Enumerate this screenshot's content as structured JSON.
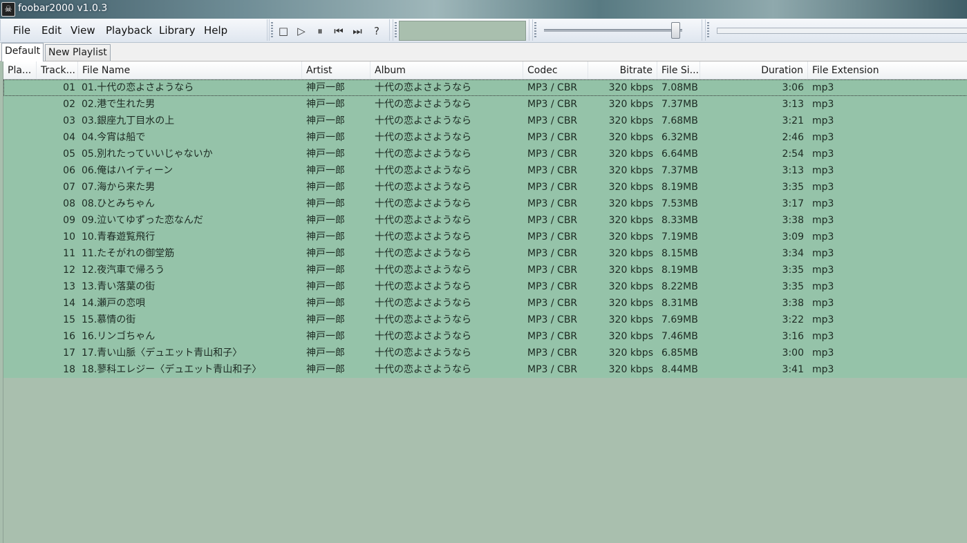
{
  "window": {
    "title": "foobar2000 v1.0.3",
    "icon": "skull-icon"
  },
  "menu": {
    "items": [
      {
        "label": "File"
      },
      {
        "label": "Edit"
      },
      {
        "label": "View"
      },
      {
        "label": "Playback"
      },
      {
        "label": "Library"
      },
      {
        "label": "Help"
      }
    ]
  },
  "transport": {
    "stop": "□",
    "play": "▷",
    "pause": "⏸",
    "prev": "⏮",
    "next": "⏭",
    "random": "?"
  },
  "volume": {
    "level": 0.95
  },
  "tabs": [
    {
      "label": "Default",
      "active": true
    },
    {
      "label": "New Playlist",
      "active": false
    }
  ],
  "columns": {
    "playing": "Pla...",
    "track": "Track...",
    "file_name": "File Name",
    "artist": "Artist",
    "album": "Album",
    "codec": "Codec",
    "bitrate": "Bitrate",
    "file_size": "File Si...",
    "duration": "Duration",
    "extension": "File Extension"
  },
  "rows": [
    {
      "track": "01",
      "file": "01.十代の恋よさようなら",
      "artist": "神戸一郎",
      "album": "十代の恋よさようなら",
      "codec": "MP3 / CBR",
      "bitrate": "320 kbps",
      "size": "7.08MB",
      "duration": "3:06",
      "ext": "mp3"
    },
    {
      "track": "02",
      "file": "02.港で生れた男",
      "artist": "神戸一郎",
      "album": "十代の恋よさようなら",
      "codec": "MP3 / CBR",
      "bitrate": "320 kbps",
      "size": "7.37MB",
      "duration": "3:13",
      "ext": "mp3"
    },
    {
      "track": "03",
      "file": "03.銀座九丁目水の上",
      "artist": "神戸一郎",
      "album": "十代の恋よさようなら",
      "codec": "MP3 / CBR",
      "bitrate": "320 kbps",
      "size": "7.68MB",
      "duration": "3:21",
      "ext": "mp3"
    },
    {
      "track": "04",
      "file": "04.今宵は船で",
      "artist": "神戸一郎",
      "album": "十代の恋よさようなら",
      "codec": "MP3 / CBR",
      "bitrate": "320 kbps",
      "size": "6.32MB",
      "duration": "2:46",
      "ext": "mp3"
    },
    {
      "track": "05",
      "file": "05.別れたっていいじゃないか",
      "artist": "神戸一郎",
      "album": "十代の恋よさようなら",
      "codec": "MP3 / CBR",
      "bitrate": "320 kbps",
      "size": "6.64MB",
      "duration": "2:54",
      "ext": "mp3"
    },
    {
      "track": "06",
      "file": "06.俺はハイティーン",
      "artist": "神戸一郎",
      "album": "十代の恋よさようなら",
      "codec": "MP3 / CBR",
      "bitrate": "320 kbps",
      "size": "7.37MB",
      "duration": "3:13",
      "ext": "mp3"
    },
    {
      "track": "07",
      "file": "07.海から来た男",
      "artist": "神戸一郎",
      "album": "十代の恋よさようなら",
      "codec": "MP3 / CBR",
      "bitrate": "320 kbps",
      "size": "8.19MB",
      "duration": "3:35",
      "ext": "mp3"
    },
    {
      "track": "08",
      "file": "08.ひとみちゃん",
      "artist": "神戸一郎",
      "album": "十代の恋よさようなら",
      "codec": "MP3 / CBR",
      "bitrate": "320 kbps",
      "size": "7.53MB",
      "duration": "3:17",
      "ext": "mp3"
    },
    {
      "track": "09",
      "file": "09.泣いてゆずった恋なんだ",
      "artist": "神戸一郎",
      "album": "十代の恋よさようなら",
      "codec": "MP3 / CBR",
      "bitrate": "320 kbps",
      "size": "8.33MB",
      "duration": "3:38",
      "ext": "mp3"
    },
    {
      "track": "10",
      "file": "10.青春遊覧飛行",
      "artist": "神戸一郎",
      "album": "十代の恋よさようなら",
      "codec": "MP3 / CBR",
      "bitrate": "320 kbps",
      "size": "7.19MB",
      "duration": "3:09",
      "ext": "mp3"
    },
    {
      "track": "11",
      "file": "11.たそがれの御堂筋",
      "artist": "神戸一郎",
      "album": "十代の恋よさようなら",
      "codec": "MP3 / CBR",
      "bitrate": "320 kbps",
      "size": "8.15MB",
      "duration": "3:34",
      "ext": "mp3"
    },
    {
      "track": "12",
      "file": "12.夜汽車で帰ろう",
      "artist": "神戸一郎",
      "album": "十代の恋よさようなら",
      "codec": "MP3 / CBR",
      "bitrate": "320 kbps",
      "size": "8.19MB",
      "duration": "3:35",
      "ext": "mp3"
    },
    {
      "track": "13",
      "file": "13.青い落葉の街",
      "artist": "神戸一郎",
      "album": "十代の恋よさようなら",
      "codec": "MP3 / CBR",
      "bitrate": "320 kbps",
      "size": "8.22MB",
      "duration": "3:35",
      "ext": "mp3"
    },
    {
      "track": "14",
      "file": "14.瀬戸の恋唄",
      "artist": "神戸一郎",
      "album": "十代の恋よさようなら",
      "codec": "MP3 / CBR",
      "bitrate": "320 kbps",
      "size": "8.31MB",
      "duration": "3:38",
      "ext": "mp3"
    },
    {
      "track": "15",
      "file": "15.慕情の街",
      "artist": "神戸一郎",
      "album": "十代の恋よさようなら",
      "codec": "MP3 / CBR",
      "bitrate": "320 kbps",
      "size": "7.69MB",
      "duration": "3:22",
      "ext": "mp3"
    },
    {
      "track": "16",
      "file": "16.リンゴちゃん",
      "artist": "神戸一郎",
      "album": "十代の恋よさようなら",
      "codec": "MP3 / CBR",
      "bitrate": "320 kbps",
      "size": "7.46MB",
      "duration": "3:16",
      "ext": "mp3"
    },
    {
      "track": "17",
      "file": "17.青い山脈〈デュエット青山和子〉",
      "artist": "神戸一郎",
      "album": "十代の恋よさようなら",
      "codec": "MP3 / CBR",
      "bitrate": "320 kbps",
      "size": "6.85MB",
      "duration": "3:00",
      "ext": "mp3"
    },
    {
      "track": "18",
      "file": "18.蓼科エレジー〈デュエット青山和子〉",
      "artist": "神戸一郎",
      "album": "十代の恋よさようなら",
      "codec": "MP3 / CBR",
      "bitrate": "320 kbps",
      "size": "8.44MB",
      "duration": "3:41",
      "ext": "mp3"
    }
  ]
}
